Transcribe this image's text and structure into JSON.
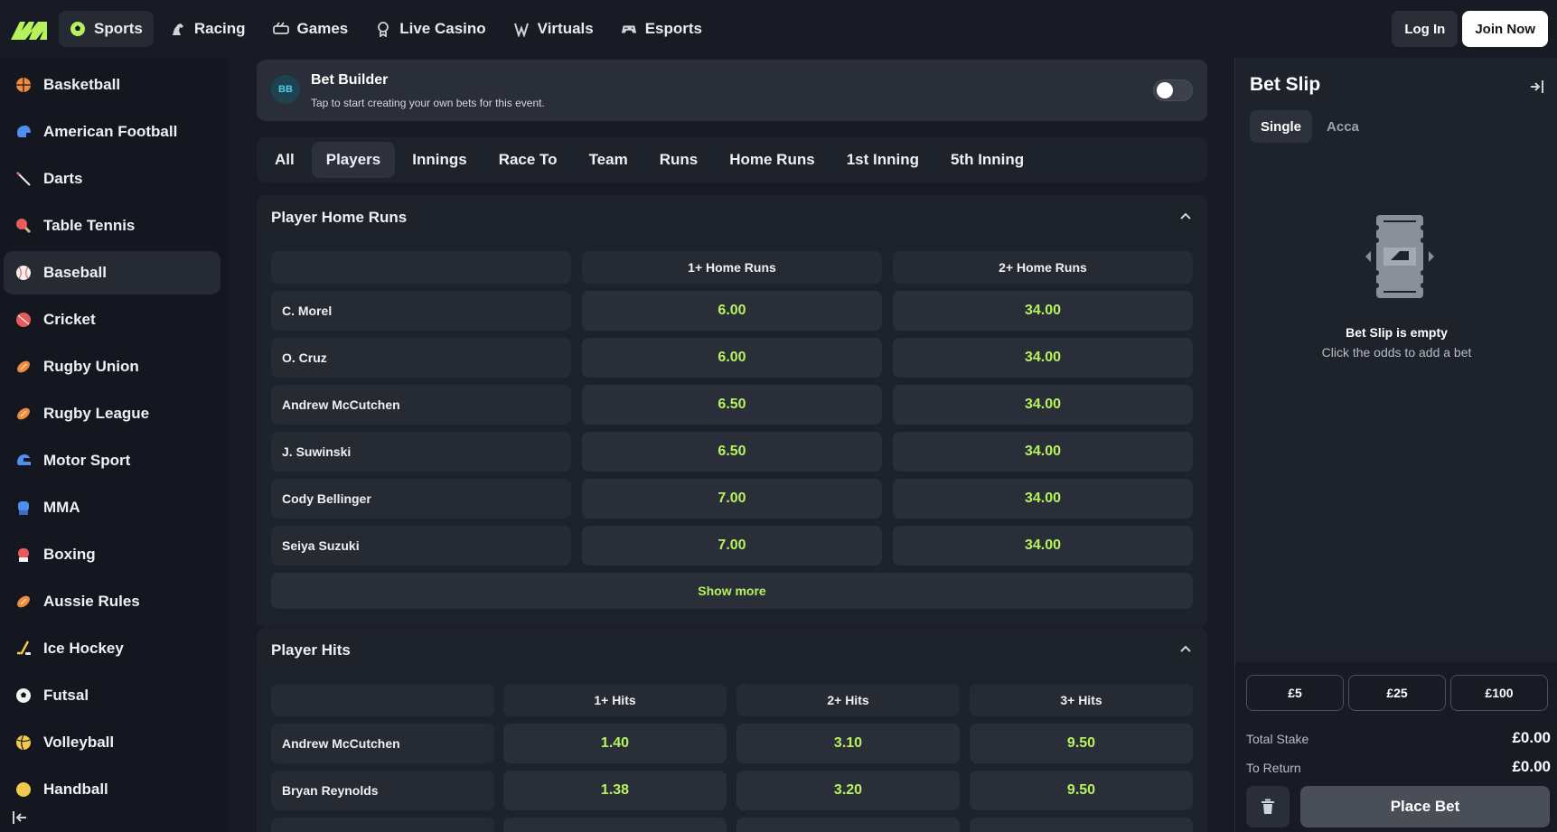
{
  "nav": {
    "items": [
      {
        "label": "Sports",
        "icon": "soccer-ball-icon"
      },
      {
        "label": "Racing",
        "icon": "horse-icon"
      },
      {
        "label": "Games",
        "icon": "games-icon"
      },
      {
        "label": "Live Casino",
        "icon": "casino-icon"
      },
      {
        "label": "Virtuals",
        "icon": "virtuals-icon"
      },
      {
        "label": "Esports",
        "icon": "gamepad-icon"
      }
    ],
    "active": "Sports",
    "login_label": "Log In",
    "join_label": "Join Now"
  },
  "sidebar": {
    "items": [
      {
        "label": "Basketball"
      },
      {
        "label": "American Football"
      },
      {
        "label": "Darts"
      },
      {
        "label": "Table Tennis"
      },
      {
        "label": "Baseball"
      },
      {
        "label": "Cricket"
      },
      {
        "label": "Rugby Union"
      },
      {
        "label": "Rugby League"
      },
      {
        "label": "Motor Sport"
      },
      {
        "label": "MMA"
      },
      {
        "label": "Boxing"
      },
      {
        "label": "Aussie Rules"
      },
      {
        "label": "Ice Hockey"
      },
      {
        "label": "Futsal"
      },
      {
        "label": "Volleyball"
      },
      {
        "label": "Handball"
      }
    ],
    "active": "Baseball"
  },
  "bet_builder": {
    "badge": "BB",
    "title": "Bet Builder",
    "subtitle": "Tap to start creating your own bets for this event."
  },
  "tabs": {
    "items": [
      "All",
      "Players",
      "Innings",
      "Race To",
      "Team",
      "Runs",
      "Home Runs",
      "1st Inning",
      "5th Inning"
    ],
    "active": "Players"
  },
  "markets": {
    "home_runs": {
      "title": "Player Home Runs",
      "columns": [
        "1+ Home Runs",
        "2+ Home Runs"
      ],
      "rows": [
        {
          "name": "C. Morel",
          "odds": [
            "6.00",
            "34.00"
          ]
        },
        {
          "name": "O. Cruz",
          "odds": [
            "6.00",
            "34.00"
          ]
        },
        {
          "name": "Andrew McCutchen",
          "odds": [
            "6.50",
            "34.00"
          ]
        },
        {
          "name": "J. Suwinski",
          "odds": [
            "6.50",
            "34.00"
          ]
        },
        {
          "name": "Cody Bellinger",
          "odds": [
            "7.00",
            "34.00"
          ]
        },
        {
          "name": "Seiya Suzuki",
          "odds": [
            "7.00",
            "34.00"
          ]
        }
      ],
      "show_more": "Show more"
    },
    "hits": {
      "title": "Player Hits",
      "columns": [
        "1+ Hits",
        "2+ Hits",
        "3+ Hits"
      ],
      "rows": [
        {
          "name": "Andrew McCutchen",
          "odds": [
            "1.40",
            "3.10",
            "9.50"
          ]
        },
        {
          "name": "Bryan Reynolds",
          "odds": [
            "1.38",
            "3.20",
            "9.50"
          ]
        }
      ]
    }
  },
  "betslip": {
    "title": "Bet Slip",
    "tabs": [
      "Single",
      "Acca"
    ],
    "active_tab": "Single",
    "empty_title": "Bet Slip is empty",
    "empty_sub": "Click the odds to add a bet",
    "stakes": [
      "£5",
      "£25",
      "£100"
    ],
    "total_stake_label": "Total Stake",
    "total_stake": "£0.00",
    "to_return_label": "To Return",
    "to_return": "£0.00",
    "place_label": "Place Bet"
  },
  "colors": {
    "accent": "#b6f25c",
    "background": "#14171f",
    "panel": "#1e222a"
  }
}
